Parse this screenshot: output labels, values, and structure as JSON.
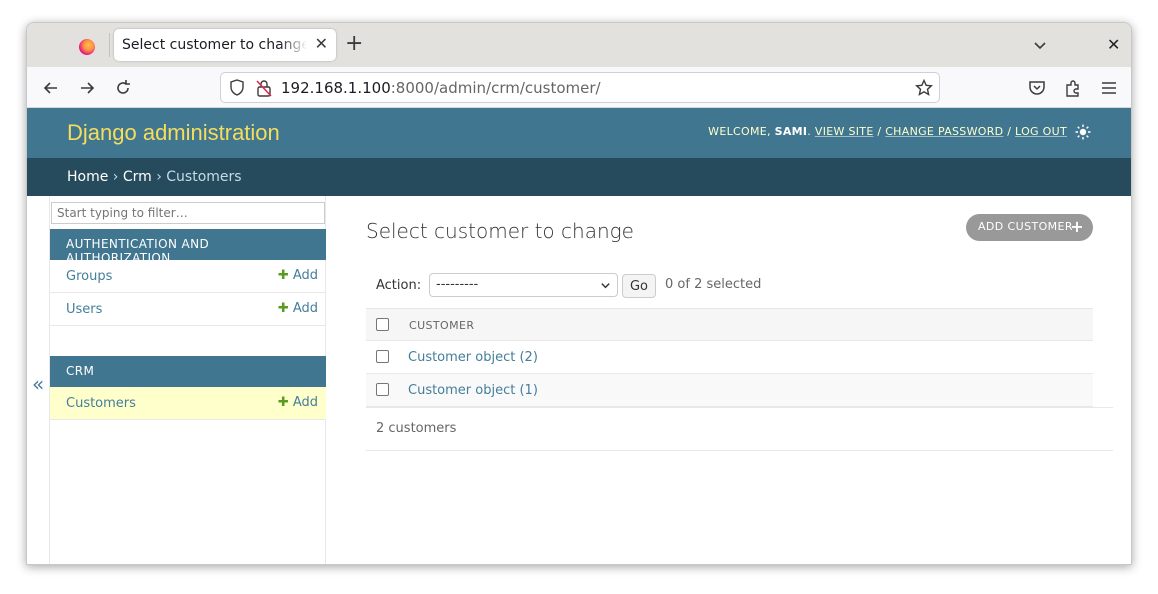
{
  "browser": {
    "tab_title": "Select customer to change | Django site admin",
    "url_host": "192.168.1.100",
    "url_path": ":8000/admin/crm/customer/"
  },
  "header": {
    "branding": "Django administration",
    "welcome": "WELCOME,",
    "username": "SAMI",
    "view_site": "VIEW SITE",
    "change_password": "CHANGE PASSWORD",
    "log_out": "LOG OUT"
  },
  "breadcrumbs": {
    "home": "Home",
    "app": "Crm",
    "current": "Customers"
  },
  "sidebar": {
    "filter_placeholder": "Start typing to filter…",
    "collapse": "«",
    "modules": [
      {
        "title": "AUTHENTICATION AND AUTHORIZATION",
        "items": [
          {
            "label": "Groups",
            "add": "Add"
          },
          {
            "label": "Users",
            "add": "Add"
          }
        ]
      },
      {
        "title": "CRM",
        "items": [
          {
            "label": "Customers",
            "add": "Add"
          }
        ]
      }
    ]
  },
  "main": {
    "title": "Select customer to change",
    "add_button": "ADD CUSTOMER",
    "action_label": "Action:",
    "action_value": "---------",
    "go_label": "Go",
    "selected_count": "0 of 2 selected",
    "column_header": "CUSTOMER",
    "rows": [
      "Customer object (2)",
      "Customer object (1)"
    ],
    "footer": "2 customers"
  }
}
